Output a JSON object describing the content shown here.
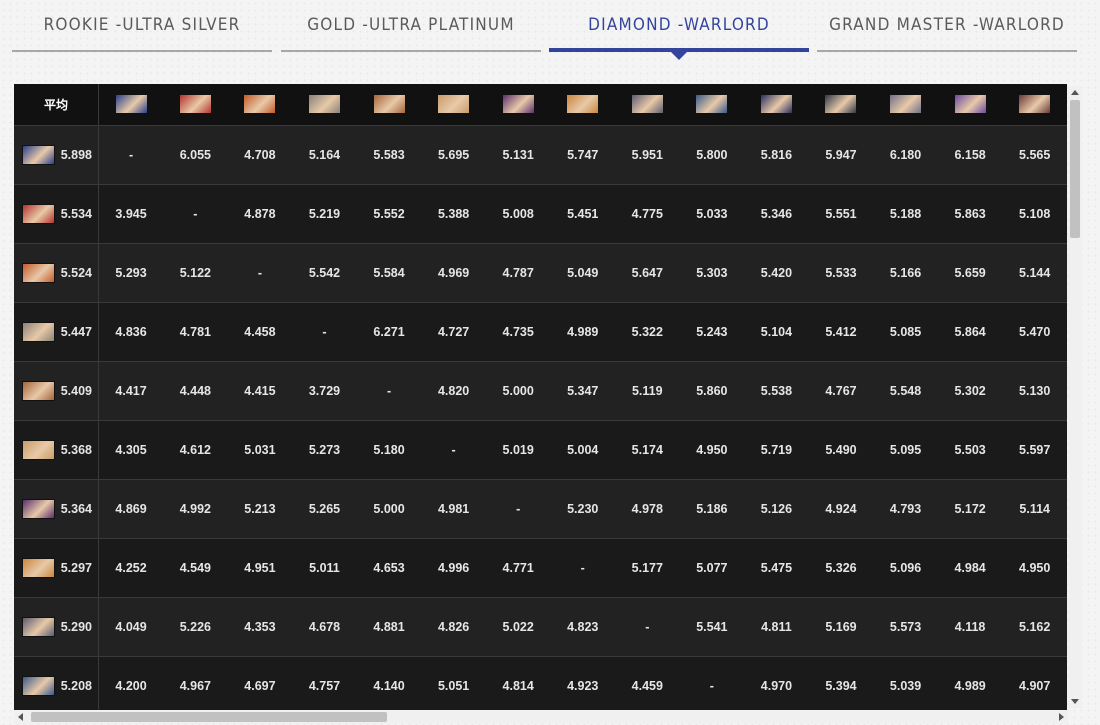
{
  "tabs": [
    {
      "label": "ROOKIE -ULTRA SILVER",
      "active": false
    },
    {
      "label": "GOLD -ULTRA PLATINUM",
      "active": false
    },
    {
      "label": "DIAMOND -WARLORD",
      "active": true
    },
    {
      "label": "GRAND MASTER -WARLORD",
      "active": false
    }
  ],
  "table": {
    "corner_label": "平均",
    "characters": [
      {
        "icon": "fighter-1-portrait-icon",
        "color": "#2b3f8a"
      },
      {
        "icon": "fighter-2-portrait-icon",
        "color": "#b4332d"
      },
      {
        "icon": "fighter-3-portrait-icon",
        "color": "#c25a2a"
      },
      {
        "icon": "fighter-4-portrait-icon",
        "color": "#8a8078"
      },
      {
        "icon": "fighter-5-portrait-icon",
        "color": "#a3653d"
      },
      {
        "icon": "fighter-6-portrait-icon",
        "color": "#c89c6a"
      },
      {
        "icon": "fighter-7-portrait-icon",
        "color": "#5b2f6e"
      },
      {
        "icon": "fighter-8-portrait-icon",
        "color": "#c8863f"
      },
      {
        "icon": "fighter-9-portrait-icon",
        "color": "#5c5c70"
      },
      {
        "icon": "fighter-10-portrait-icon",
        "color": "#3a5a8a"
      },
      {
        "icon": "fighter-11-portrait-icon",
        "color": "#2b3060"
      },
      {
        "icon": "fighter-12-portrait-icon",
        "color": "#303848"
      },
      {
        "icon": "fighter-13-portrait-icon",
        "color": "#70708a"
      },
      {
        "icon": "fighter-14-portrait-icon",
        "color": "#6a4aa0"
      },
      {
        "icon": "fighter-15-portrait-icon",
        "color": "#6a3a3a"
      }
    ],
    "rows": [
      {
        "avg": "5.898",
        "values": [
          "-",
          "6.055",
          "4.708",
          "5.164",
          "5.583",
          "5.695",
          "5.131",
          "5.747",
          "5.951",
          "5.800",
          "5.816",
          "5.947",
          "6.180",
          "6.158",
          "5.565"
        ]
      },
      {
        "avg": "5.534",
        "values": [
          "3.945",
          "-",
          "4.878",
          "5.219",
          "5.552",
          "5.388",
          "5.008",
          "5.451",
          "4.775",
          "5.033",
          "5.346",
          "5.551",
          "5.188",
          "5.863",
          "5.108"
        ]
      },
      {
        "avg": "5.524",
        "values": [
          "5.293",
          "5.122",
          "-",
          "5.542",
          "5.584",
          "4.969",
          "4.787",
          "5.049",
          "5.647",
          "5.303",
          "5.420",
          "5.533",
          "5.166",
          "5.659",
          "5.144"
        ]
      },
      {
        "avg": "5.447",
        "values": [
          "4.836",
          "4.781",
          "4.458",
          "-",
          "6.271",
          "4.727",
          "4.735",
          "4.989",
          "5.322",
          "5.243",
          "5.104",
          "5.412",
          "5.085",
          "5.864",
          "5.470"
        ]
      },
      {
        "avg": "5.409",
        "values": [
          "4.417",
          "4.448",
          "4.415",
          "3.729",
          "-",
          "4.820",
          "5.000",
          "5.347",
          "5.119",
          "5.860",
          "5.538",
          "4.767",
          "5.548",
          "5.302",
          "5.130"
        ]
      },
      {
        "avg": "5.368",
        "values": [
          "4.305",
          "4.612",
          "5.031",
          "5.273",
          "5.180",
          "-",
          "5.019",
          "5.004",
          "5.174",
          "4.950",
          "5.719",
          "5.490",
          "5.095",
          "5.503",
          "5.597"
        ]
      },
      {
        "avg": "5.364",
        "values": [
          "4.869",
          "4.992",
          "5.213",
          "5.265",
          "5.000",
          "4.981",
          "-",
          "5.230",
          "4.978",
          "5.186",
          "5.126",
          "4.924",
          "4.793",
          "5.172",
          "5.114"
        ]
      },
      {
        "avg": "5.297",
        "values": [
          "4.252",
          "4.549",
          "4.951",
          "5.011",
          "4.653",
          "4.996",
          "4.771",
          "-",
          "5.177",
          "5.077",
          "5.475",
          "5.326",
          "5.096",
          "4.984",
          "4.950"
        ]
      },
      {
        "avg": "5.290",
        "values": [
          "4.049",
          "5.226",
          "4.353",
          "4.678",
          "4.881",
          "4.826",
          "5.022",
          "4.823",
          "-",
          "5.541",
          "4.811",
          "5.169",
          "5.573",
          "4.118",
          "5.162"
        ]
      },
      {
        "avg": "5.208",
        "values": [
          "4.200",
          "4.967",
          "4.697",
          "4.757",
          "4.140",
          "5.051",
          "4.814",
          "4.923",
          "4.459",
          "-",
          "4.970",
          "5.394",
          "5.039",
          "4.989",
          "4.907"
        ]
      }
    ]
  },
  "colors": {
    "accent": "#34449c",
    "tab_inactive": "#5a5a5a",
    "table_bg": "#1d1d1d"
  }
}
